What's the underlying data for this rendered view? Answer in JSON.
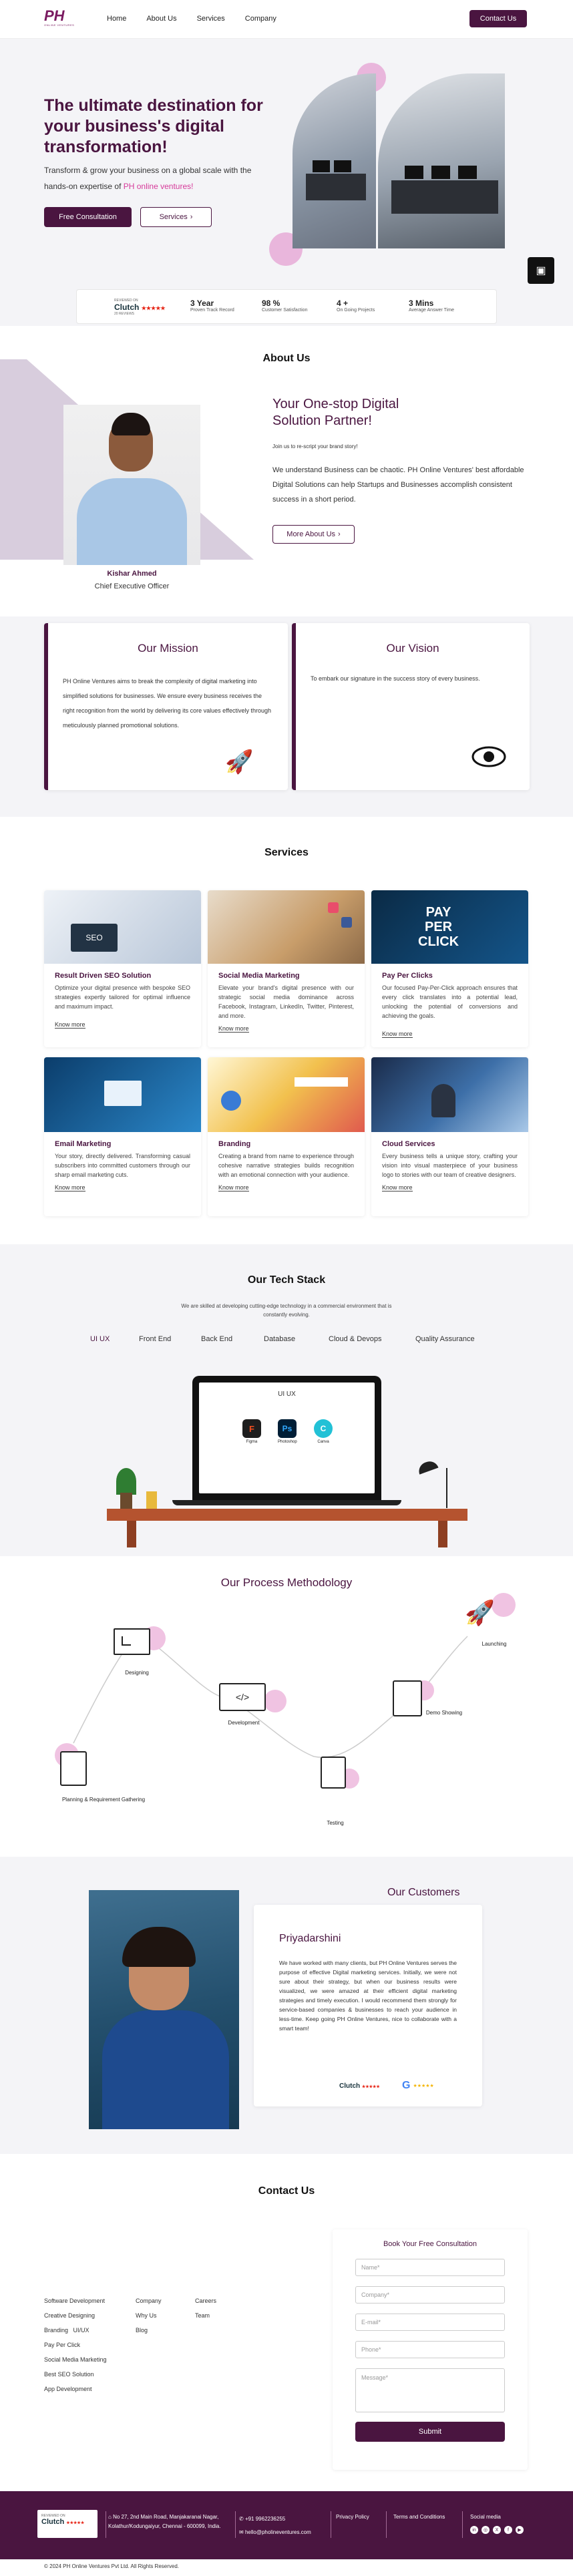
{
  "header": {
    "logo_text": "PH",
    "logo_tagline": "ONLINE VENTURES",
    "nav": [
      "Home",
      "About Us",
      "Services",
      "Company"
    ],
    "cta": "Contact Us"
  },
  "hero": {
    "title": "The ultimate destination for your business's digital transformation!",
    "subtitle_part1": "Transform & grow your business on a global scale with the hands-on expertise of ",
    "subtitle_highlight": "PH online ventures!",
    "primary_button": "Free Consultation",
    "secondary_button": "Services",
    "stats": [
      {
        "num": "3 Year",
        "label": "Proven Track Record"
      },
      {
        "num": "98 %",
        "label": "Customer Satisfaction"
      },
      {
        "num": "4 +",
        "label": "On Going Projects"
      },
      {
        "num": "3 Mins",
        "label": "Average Answer Time"
      }
    ],
    "clutch_label": "Clutch",
    "clutch_reviewed": "REVIEWED ON",
    "clutch_reviews": "20 REVIEWS"
  },
  "about": {
    "section_title": "About Us",
    "heading": "Your One-stop Digital Solution Partner!",
    "tagline": "Join us to re-script your brand story!",
    "paragraph": "We understand Business can be chaotic. PH Online Ventures' best affordable Digital Solutions can help Startups and Businesses accomplish consistent success in a short period.",
    "button": "More About Us",
    "person_name": "Kishar Ahmed",
    "person_role": "Chief Executive Officer"
  },
  "mission": {
    "title": "Our Mission",
    "text": "PH Online Ventures aims to break the complexity of digital marketing into simplified solutions for businesses. We ensure every business receives the right recognition from the world by delivering its core values effectively through meticulously planned promotional solutions."
  },
  "vision": {
    "title": "Our Vision",
    "text": "To embark our signature in the success story of every business."
  },
  "services": {
    "section_title": "Services",
    "know_more": "Know more",
    "items": [
      {
        "title": "Result Driven SEO Solution",
        "desc": "Optimize your digital presence with bespoke SEO strategies expertly tailored for optimal influence and maximum impact."
      },
      {
        "title": "Social Media Marketing",
        "desc": "Elevate your brand's digital presence with our strategic social media dominance across Facebook, Instagram, LinkedIn, Twitter, Pinterest, and more."
      },
      {
        "title": "Pay Per Clicks",
        "desc": "Our focused Pay-Per-Click approach ensures that every click translates into a potential lead, unlocking the potential of conversions and achieving the goals."
      },
      {
        "title": "Email Marketing",
        "desc": "Your story, directly delivered. Transforming casual subscribers into committed customers through our sharp email marketing cuts."
      },
      {
        "title": "Branding",
        "desc": "Creating a brand from name to experience through cohesive narrative strategies builds recognition with an emotional connection with your audience."
      },
      {
        "title": "Cloud Services",
        "desc": "Every business tells a unique story, crafting your vision into visual masterpiece of your business logo to stories with our team of creative designers."
      }
    ]
  },
  "tech": {
    "section_title": "Our Tech Stack",
    "subtitle": "We are skilled at developing cutting-edge technology in a commercial environment that is constantly evolving.",
    "tabs": [
      "UI UX",
      "Front End",
      "Back End",
      "Database",
      "Cloud & Devops",
      "Quality Assurance"
    ],
    "screen_title": "UI UX",
    "tools": [
      {
        "name": "Figma",
        "color": "#1e1e1e",
        "glyph": "F"
      },
      {
        "name": "Photoshop",
        "color": "#001e36",
        "glyph": "Ps"
      },
      {
        "name": "Canva",
        "color": "#22c1d6",
        "glyph": "C"
      }
    ]
  },
  "process": {
    "section_title": "Our Process Methodology",
    "steps": [
      "Designing",
      "Development",
      "Launching",
      "Demo Showing",
      "Testing",
      "Planning & Requirement Gathering"
    ]
  },
  "customers": {
    "section_title": "Our Customers",
    "name": "Priyadarshini",
    "review": "We have worked with many clients, but PH Online Ventures serves the purpose of effective Digital marketing services. Initially, we were not sure about their strategy, but when our business results were visualized, we were amazed at their efficient digital marketing strategies and timely execution. I would recommend them strongly for service-based companies & businesses to reach your audience in less-time. Keep going PH Online Ventures, nice to collaborate with a smart team!",
    "clutch": "Clutch",
    "google": "G"
  },
  "contact": {
    "section_title": "Contact Us",
    "form_title": "Book Your Free Consultation",
    "placeholders": [
      "Name*",
      "Company*",
      "E-mail*",
      "Phone*",
      "Message*"
    ],
    "submit": "Submit",
    "col1": [
      "Software Development",
      "Creative Designing",
      "Branding",
      "UI/UX",
      "Pay Per Click",
      "Social Media Marketing",
      "Best SEO Solution",
      "App Development"
    ],
    "col2": [
      "Company",
      "Why Us",
      "Blog"
    ],
    "col3": [
      "Careers",
      "Team"
    ]
  },
  "footer": {
    "address": "No 27, 2nd Main Road, Manjakaranai Nagar, Kolathur/Kodungaiyur, Chennai - 600099, India.",
    "phone": "+91 9962236255",
    "email": "hello@pholineventures.com",
    "privacy": "Privacy Policy",
    "terms": "Terms and Conditions",
    "social": "Social media",
    "copyright": "© 2024 PH Online Ventures Pvt Ltd. All Rights Reserved."
  }
}
